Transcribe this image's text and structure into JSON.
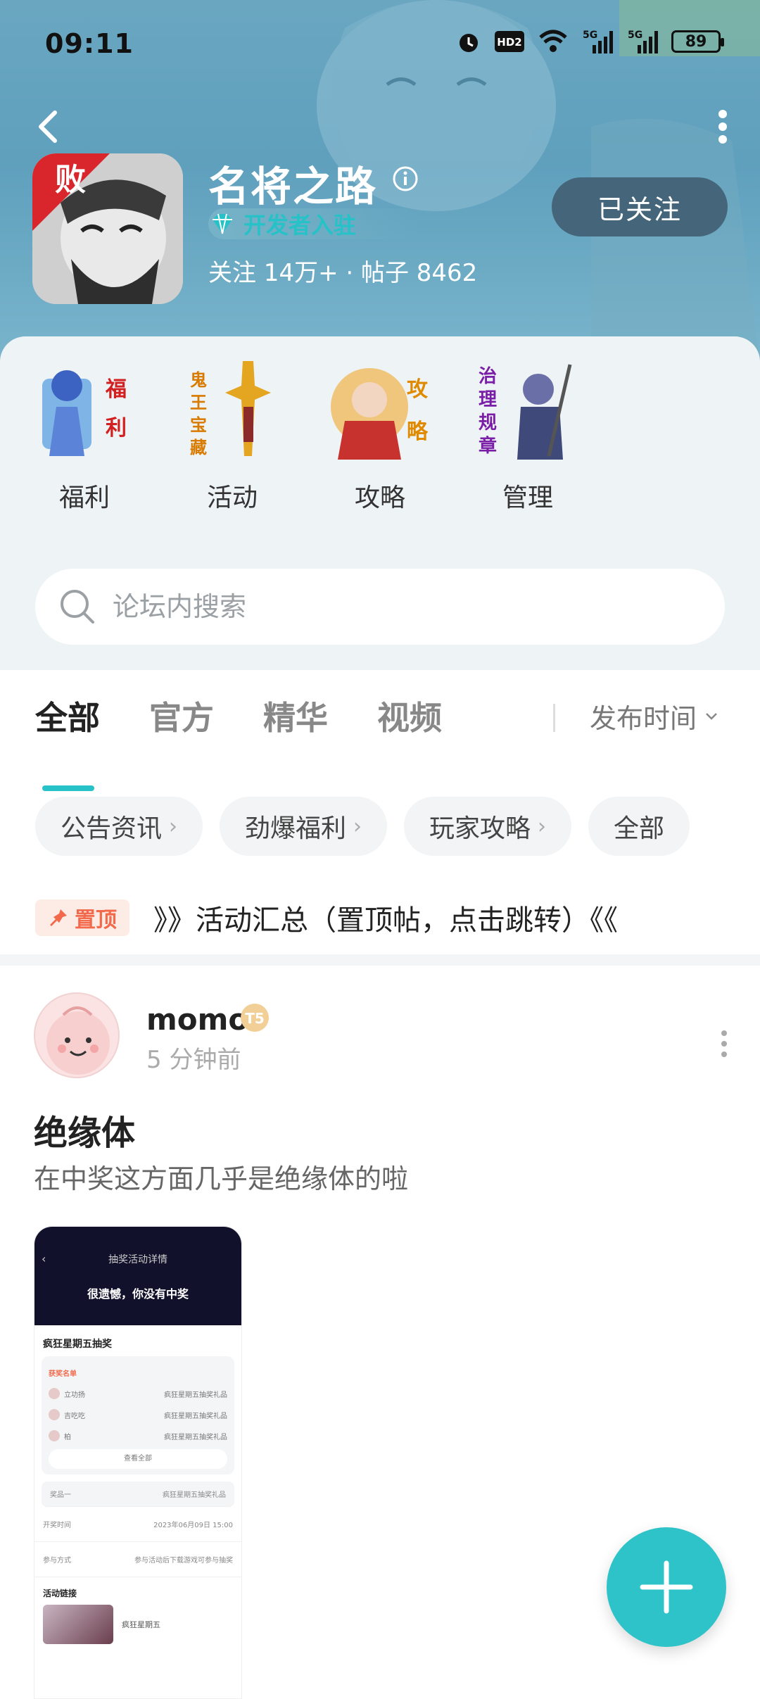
{
  "statusbar": {
    "time": "09:11",
    "hd_label": "HD2",
    "signal1": "5G",
    "signal2": "5G",
    "battery": "89"
  },
  "forum": {
    "title": "名将之路",
    "badge_text": "开发者入驻",
    "stats": "关注 14万+ · 帖子 8462",
    "follow_label": "已关注",
    "icon_text": "败"
  },
  "quick_links": [
    {
      "label": "福利",
      "art_text": "福利"
    },
    {
      "label": "活动",
      "art_text": "鬼王宝藏"
    },
    {
      "label": "攻略",
      "art_text": "攻略"
    },
    {
      "label": "管理",
      "art_text": "治理规章"
    }
  ],
  "search": {
    "placeholder": "论坛内搜索"
  },
  "tabs": [
    {
      "label": "全部",
      "active": true
    },
    {
      "label": "官方"
    },
    {
      "label": "精华"
    },
    {
      "label": "视频"
    }
  ],
  "sort": {
    "label": "发布时间"
  },
  "chips": [
    {
      "label": "公告资讯"
    },
    {
      "label": "劲爆福利"
    },
    {
      "label": "玩家攻略"
    },
    {
      "label": "全部"
    }
  ],
  "pinned": {
    "badge": "置顶",
    "title": "》》活动汇总（置顶帖，点击跳转）《《"
  },
  "post": {
    "username": "momo",
    "level": "T5",
    "time_ago": "5 分钟前",
    "title": "绝缘体",
    "body": "在中奖这方面几乎是绝缘体的啦",
    "thumb": {
      "header": "抽奖活动详情",
      "result": "很遗憾，你没有中奖",
      "event_name": "疯狂星期五抽奖",
      "winners_label": "获奖名单",
      "winners": [
        {
          "name": "立功扬",
          "prize": "疯狂星期五抽奖礼品"
        },
        {
          "name": "吉吃吃",
          "prize": "疯狂星期五抽奖礼品"
        },
        {
          "name": "柏",
          "prize": "疯狂星期五抽奖礼品"
        }
      ],
      "view_all": "查看全部",
      "prize_row": {
        "left": "奖品一",
        "right": "疯狂星期五抽奖礼品"
      },
      "draw_time": {
        "left": "开奖时间",
        "right": "2023年06月09日 15:00"
      },
      "join_method": {
        "left": "参与方式",
        "right": "参与活动后下载游戏可参与抽奖"
      },
      "link_label": "活动链接",
      "game_label": "疯狂星期五"
    }
  },
  "colors": {
    "accent": "#2ec3c8",
    "header_bg": "#5fa0bd",
    "follow_bg": "#45667a",
    "pin": "#f26a4b"
  }
}
